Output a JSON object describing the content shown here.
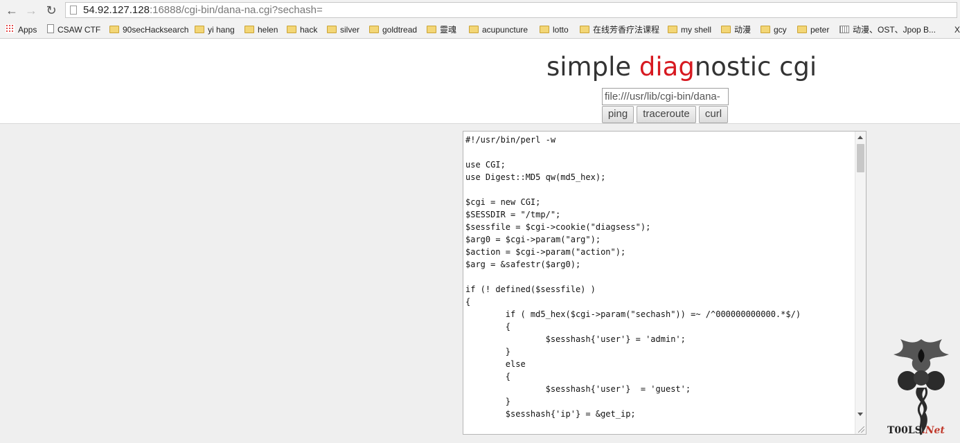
{
  "browser": {
    "url_host": "54.92.127.128",
    "url_rest": ":16888/cgi-bin/dana-na.cgi?sechash="
  },
  "bookmarks": [
    {
      "label": "Apps",
      "icon": "apps-icon"
    },
    {
      "label": "CSAW CTF",
      "icon": "page-icon"
    },
    {
      "label": "90secHacksearch",
      "icon": "folder-icon"
    },
    {
      "label": "yi hang",
      "icon": "folder-icon"
    },
    {
      "label": "helen",
      "icon": "folder-icon"
    },
    {
      "label": "hack",
      "icon": "folder-icon"
    },
    {
      "label": "silver",
      "icon": "folder-icon"
    },
    {
      "label": "goldtread",
      "icon": "folder-icon"
    },
    {
      "label": "靈魂",
      "icon": "folder-icon"
    },
    {
      "label": "acupuncture",
      "icon": "folder-icon"
    },
    {
      "label": "lotto",
      "icon": "folder-icon"
    },
    {
      "label": "在线芳香疗法课程",
      "icon": "folder-icon"
    },
    {
      "label": "my shell",
      "icon": "folder-icon"
    },
    {
      "label": "动漫",
      "icon": "folder-icon"
    },
    {
      "label": "gcy",
      "icon": "folder-icon"
    },
    {
      "label": "peter",
      "icon": "folder-icon"
    },
    {
      "label": "动漫、OST、Jpop B...",
      "icon": "grid-icon"
    },
    {
      "label": "X",
      "icon": ""
    }
  ],
  "page": {
    "title_part1": "simple ",
    "title_part2": "diag",
    "title_part3": "nostic cgi",
    "arg_value": "file:///usr/lib/cgi-bin/dana-",
    "buttons": {
      "ping": "ping",
      "traceroute": "traceroute",
      "curl": "curl"
    },
    "code": "#!/usr/bin/perl -w\n\nuse CGI;\nuse Digest::MD5 qw(md5_hex);\n\n$cgi = new CGI;\n$SESSDIR = \"/tmp/\";\n$sessfile = $cgi->cookie(\"diagsess\");\n$arg0 = $cgi->param(\"arg\");\n$action = $cgi->param(\"action\");\n$arg = &safestr($arg0);\n\nif (! defined($sessfile) )\n{\n        if ( md5_hex($cgi->param(\"sechash\")) =~ /^000000000000.*$/)\n        {\n                $sesshash{'user'} = 'admin';\n        }\n        else\n        {\n                $sesshash{'user'}  = 'guest';\n        }\n        $sesshash{'ip'} = &get_ip;"
  },
  "watermark": {
    "text_main": "T00LS",
    "text_net": ".Net"
  }
}
